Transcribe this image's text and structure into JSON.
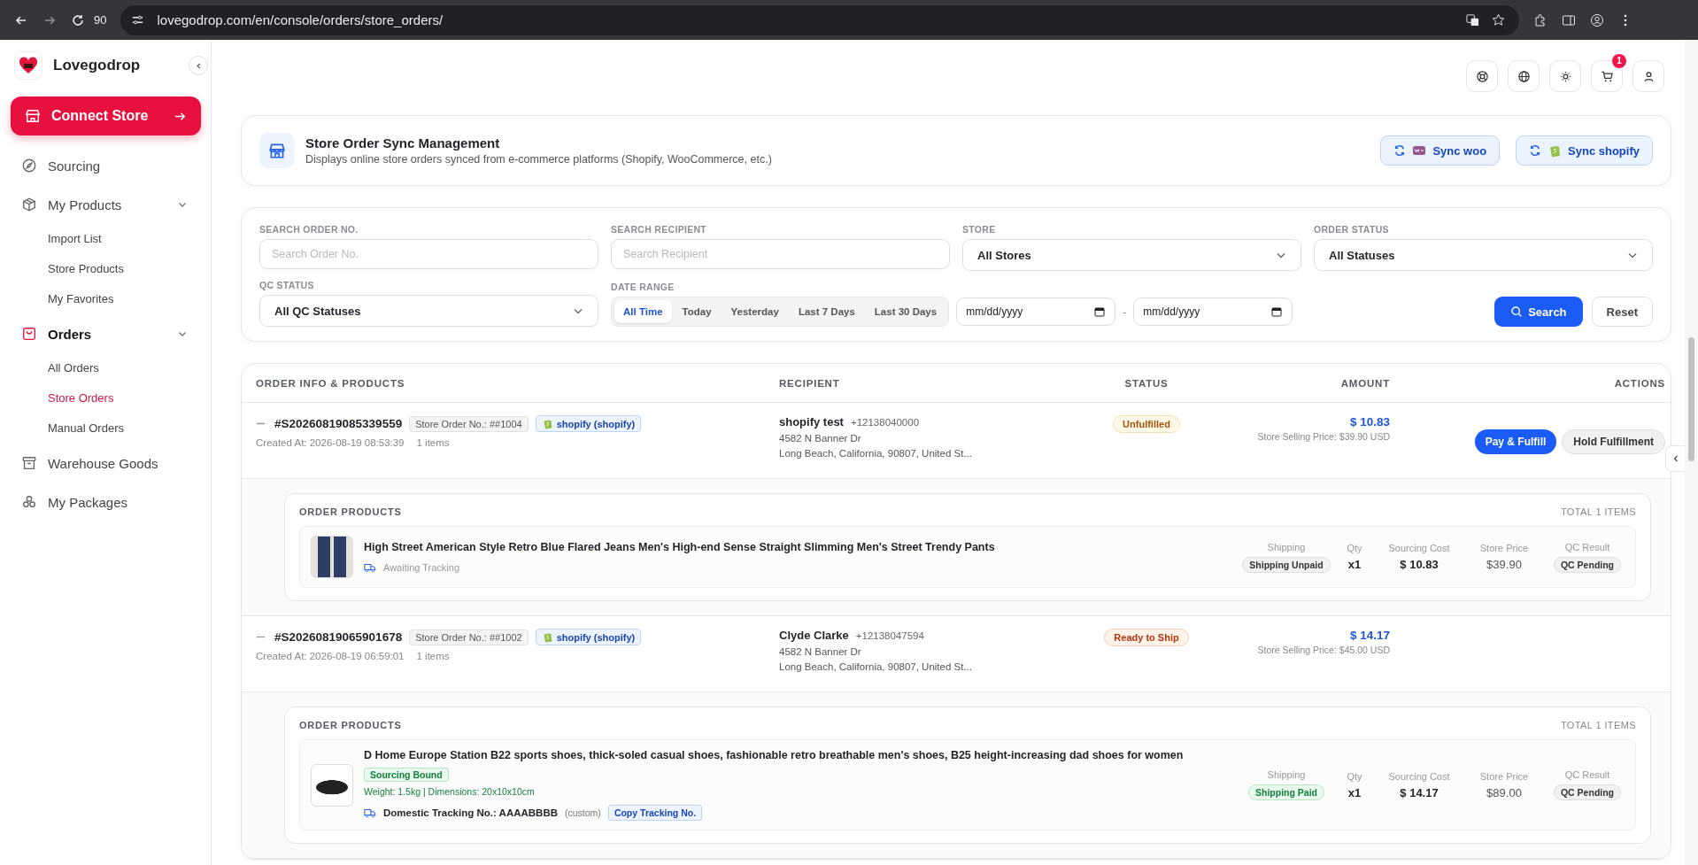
{
  "browser": {
    "zoom": "90",
    "url": "lovegodrop.com/en/console/orders/store_orders/"
  },
  "sidebar": {
    "brand": "Lovegodrop",
    "connect_button": "Connect Store",
    "items": [
      {
        "label": "Sourcing",
        "selected": false
      },
      {
        "label": "My Products",
        "selected": false,
        "expanded": true,
        "children": [
          {
            "label": "Import List",
            "selected": false
          },
          {
            "label": "Store Products",
            "selected": false
          },
          {
            "label": "My Favorites",
            "selected": false
          }
        ]
      },
      {
        "label": "Orders",
        "selected": true,
        "expanded": true,
        "children": [
          {
            "label": "All Orders",
            "selected": false
          },
          {
            "label": "Store Orders",
            "selected": true
          },
          {
            "label": "Manual Orders",
            "selected": false
          }
        ]
      },
      {
        "label": "Warehouse Goods",
        "selected": false
      },
      {
        "label": "My Packages",
        "selected": false
      }
    ]
  },
  "topbar": {
    "cart_badge": "1"
  },
  "page_header": {
    "title": "Store Order Sync Management",
    "subtitle": "Displays online store orders synced from e-commerce platforms (Shopify, WooCommerce, etc.)",
    "buttons": [
      {
        "label": "Sync woo",
        "kind": "woo"
      },
      {
        "label": "Sync shopify",
        "kind": "shopify"
      }
    ]
  },
  "filters": {
    "fields": [
      {
        "kind": "text",
        "label": "SEARCH ORDER NO.",
        "placeholder": "Search Order No."
      },
      {
        "kind": "text",
        "label": "SEARCH RECIPIENT",
        "placeholder": "Search Recipient"
      },
      {
        "kind": "select",
        "label": "STORE",
        "value": "All Stores"
      },
      {
        "kind": "select",
        "label": "ORDER STATUS",
        "value": "All Statuses"
      },
      {
        "kind": "select",
        "label": "QC STATUS",
        "value": "All QC Statuses"
      }
    ],
    "date_range": {
      "label": "DATE RANGE",
      "presets": [
        {
          "label": "All Time",
          "selected": true
        },
        {
          "label": "Today",
          "selected": false
        },
        {
          "label": "Yesterday",
          "selected": false
        },
        {
          "label": "Last 7 Days",
          "selected": false
        },
        {
          "label": "Last 30 Days",
          "selected": false
        }
      ],
      "start_placeholder": "mm/dd/yyyy",
      "separator": "-",
      "end_placeholder": "mm/dd/yyyy"
    },
    "search_button": "Search",
    "reset_button": "Reset"
  },
  "table": {
    "columns": [
      "ORDER INFO & PRODUCTS",
      "RECIPIENT",
      "STATUS",
      "AMOUNT",
      "ACTIONS"
    ],
    "orders": [
      {
        "expanded": true,
        "order_no": "#S20260819085339559",
        "store_order_no": "Store Order No.: ##1004",
        "platform": "shopify (shopify)",
        "created_at": "Created At: 2026-08-19 08:53:39",
        "items": "1 items",
        "recipient": {
          "name": "shopify test",
          "phone": "+12138040000",
          "address1": "4582 N Banner Dr",
          "address2": "Long Beach, California, 90807, United St..."
        },
        "status": {
          "label": "Unfulfilled",
          "kind": "unfulfilled"
        },
        "amount": "$ 10.83",
        "selling_price": "Store Selling Price: $39.90 USD",
        "actions": [
          {
            "label": "Pay & Fulfill",
            "kind": "primary"
          },
          {
            "label": "Hold Fulfillment",
            "kind": "secondary"
          }
        ],
        "products_block": {
          "title": "ORDER PRODUCTS",
          "total": "TOTAL 1 ITEMS",
          "products": [
            {
              "name": "High Street American Style Retro Blue Flared Jeans Men's High-end Sense Straight Slimming Men's Street Trendy Pants",
              "tracking_status": "Awaiting Tracking",
              "fields": [
                {
                  "label": "Shipping",
                  "value": "Shipping Unpaid",
                  "kind": "neutral"
                },
                {
                  "label": "Qty",
                  "value": "x1",
                  "kind": "bold"
                },
                {
                  "label": "Sourcing Cost",
                  "value": "$ 10.83",
                  "kind": "bold"
                },
                {
                  "label": "Store Price",
                  "value": "$39.90",
                  "kind": "plain"
                },
                {
                  "label": "QC Result",
                  "value": "QC Pending",
                  "kind": "neutral"
                }
              ]
            }
          ]
        }
      },
      {
        "expanded": true,
        "order_no": "#S20260819065901678",
        "store_order_no": "Store Order No.: ##1002",
        "platform": "shopify (shopify)",
        "created_at": "Created At: 2026-08-19 06:59:01",
        "items": "1 items",
        "recipient": {
          "name": "Clyde Clarke",
          "phone": "+12138047594",
          "address1": "4582 N Banner Dr",
          "address2": "Long Beach, California, 90807, United St..."
        },
        "status": {
          "label": "Ready to Ship",
          "kind": "ready"
        },
        "amount": "$ 14.17",
        "selling_price": "Store Selling Price: $45.00 USD",
        "products_block": {
          "title": "ORDER PRODUCTS",
          "total": "TOTAL 1 ITEMS",
          "products": [
            {
              "name": "D Home Europe Station B22 sports shoes, thick-soled casual shoes, fashionable retro breathable men's shoes, B25 height-increasing dad shoes for women",
              "tag": "Sourcing Bound",
              "specs": "Weight: 1.5kg | Dimensions: 20x10x10cm",
              "tracking_no": "Domestic Tracking No.: AAAABBBB",
              "tracking_source": "(custom)",
              "copy_button": "Copy Tracking No.",
              "fields": [
                {
                  "label": "Shipping",
                  "value": "Shipping Paid",
                  "kind": "success"
                },
                {
                  "label": "Qty",
                  "value": "x1",
                  "kind": "bold"
                },
                {
                  "label": "Sourcing Cost",
                  "value": "$ 14.17",
                  "kind": "bold"
                },
                {
                  "label": "Store Price",
                  "value": "$89.00",
                  "kind": "plain"
                },
                {
                  "label": "QC Result",
                  "value": "QC Pending",
                  "kind": "neutral"
                }
              ]
            }
          ]
        }
      }
    ]
  }
}
